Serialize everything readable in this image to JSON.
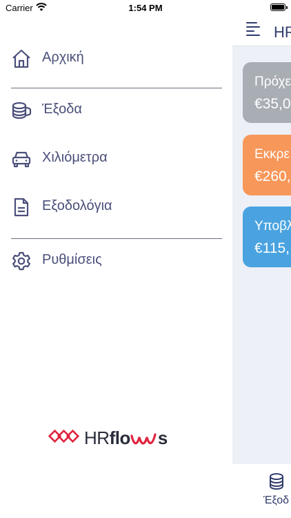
{
  "status_bar": {
    "carrier": "Carrier",
    "time": "1:54 PM"
  },
  "drawer": {
    "menu": [
      {
        "label": "Αρχική",
        "icon": "home-icon"
      },
      {
        "label": "Έξοδα",
        "icon": "coins-icon"
      },
      {
        "label": "Χιλιόμετρα",
        "icon": "car-icon"
      },
      {
        "label": "Εξοδολόγια",
        "icon": "document-icon"
      },
      {
        "label": "Ρυθμίσεις",
        "icon": "gear-icon"
      }
    ],
    "logo": {
      "prefix": "HR",
      "bold": "flo",
      "suffix": "s"
    }
  },
  "background_app": {
    "title": "HR",
    "cards": [
      {
        "label": "Πρόχε",
        "amount": "€35,0",
        "color": "#a9adb4"
      },
      {
        "label": "Εκκρε",
        "amount": "€260,",
        "color": "#f7975a"
      },
      {
        "label": "Υποβλ",
        "amount": "€115,",
        "color": "#4aa3e0"
      }
    ],
    "tab": {
      "label": "Έξοδ",
      "icon": "coins-icon"
    }
  },
  "colors": {
    "accent": "#2f3b6b",
    "menu_text": "#4a4f7a",
    "logo_red": "#e0233e",
    "background": "#edf0f7"
  }
}
